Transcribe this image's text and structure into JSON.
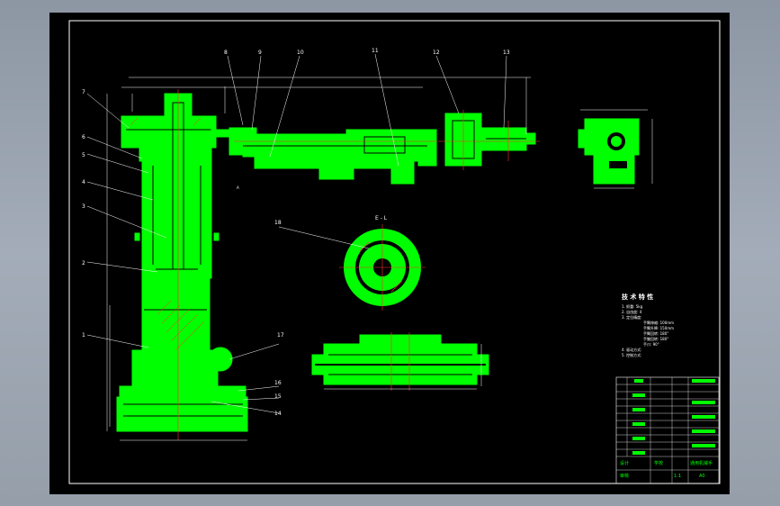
{
  "drawing": {
    "part_labels_left": [
      "7",
      "6",
      "5",
      "4",
      "3",
      "2",
      "1"
    ],
    "part_labels_top": [
      "8",
      "9",
      "10",
      "11",
      "12",
      "13"
    ],
    "part_labels_right": [
      "17",
      "16",
      "15",
      "14"
    ],
    "label_gear": "18",
    "section_label": "E - L",
    "point_a": "A"
  },
  "notes": {
    "title": "技 术 特 性",
    "lines": [
      "1. 抓重: 5kg",
      "2. 自由度: 4",
      "3. 定位精度:",
      "手臂伸缩: 100mm",
      "手臂升降: 150mm",
      "手臂回转: 180°",
      "手腕回转: 180°",
      "手爪: 90°",
      "4. 驱动方式:",
      "5. 控制方式:"
    ]
  },
  "title_block": {
    "title_text": "通用机械手",
    "designer": "设计",
    "checker": "审核",
    "drawing_no": "A0",
    "scale": "1:1",
    "school": "学校"
  }
}
